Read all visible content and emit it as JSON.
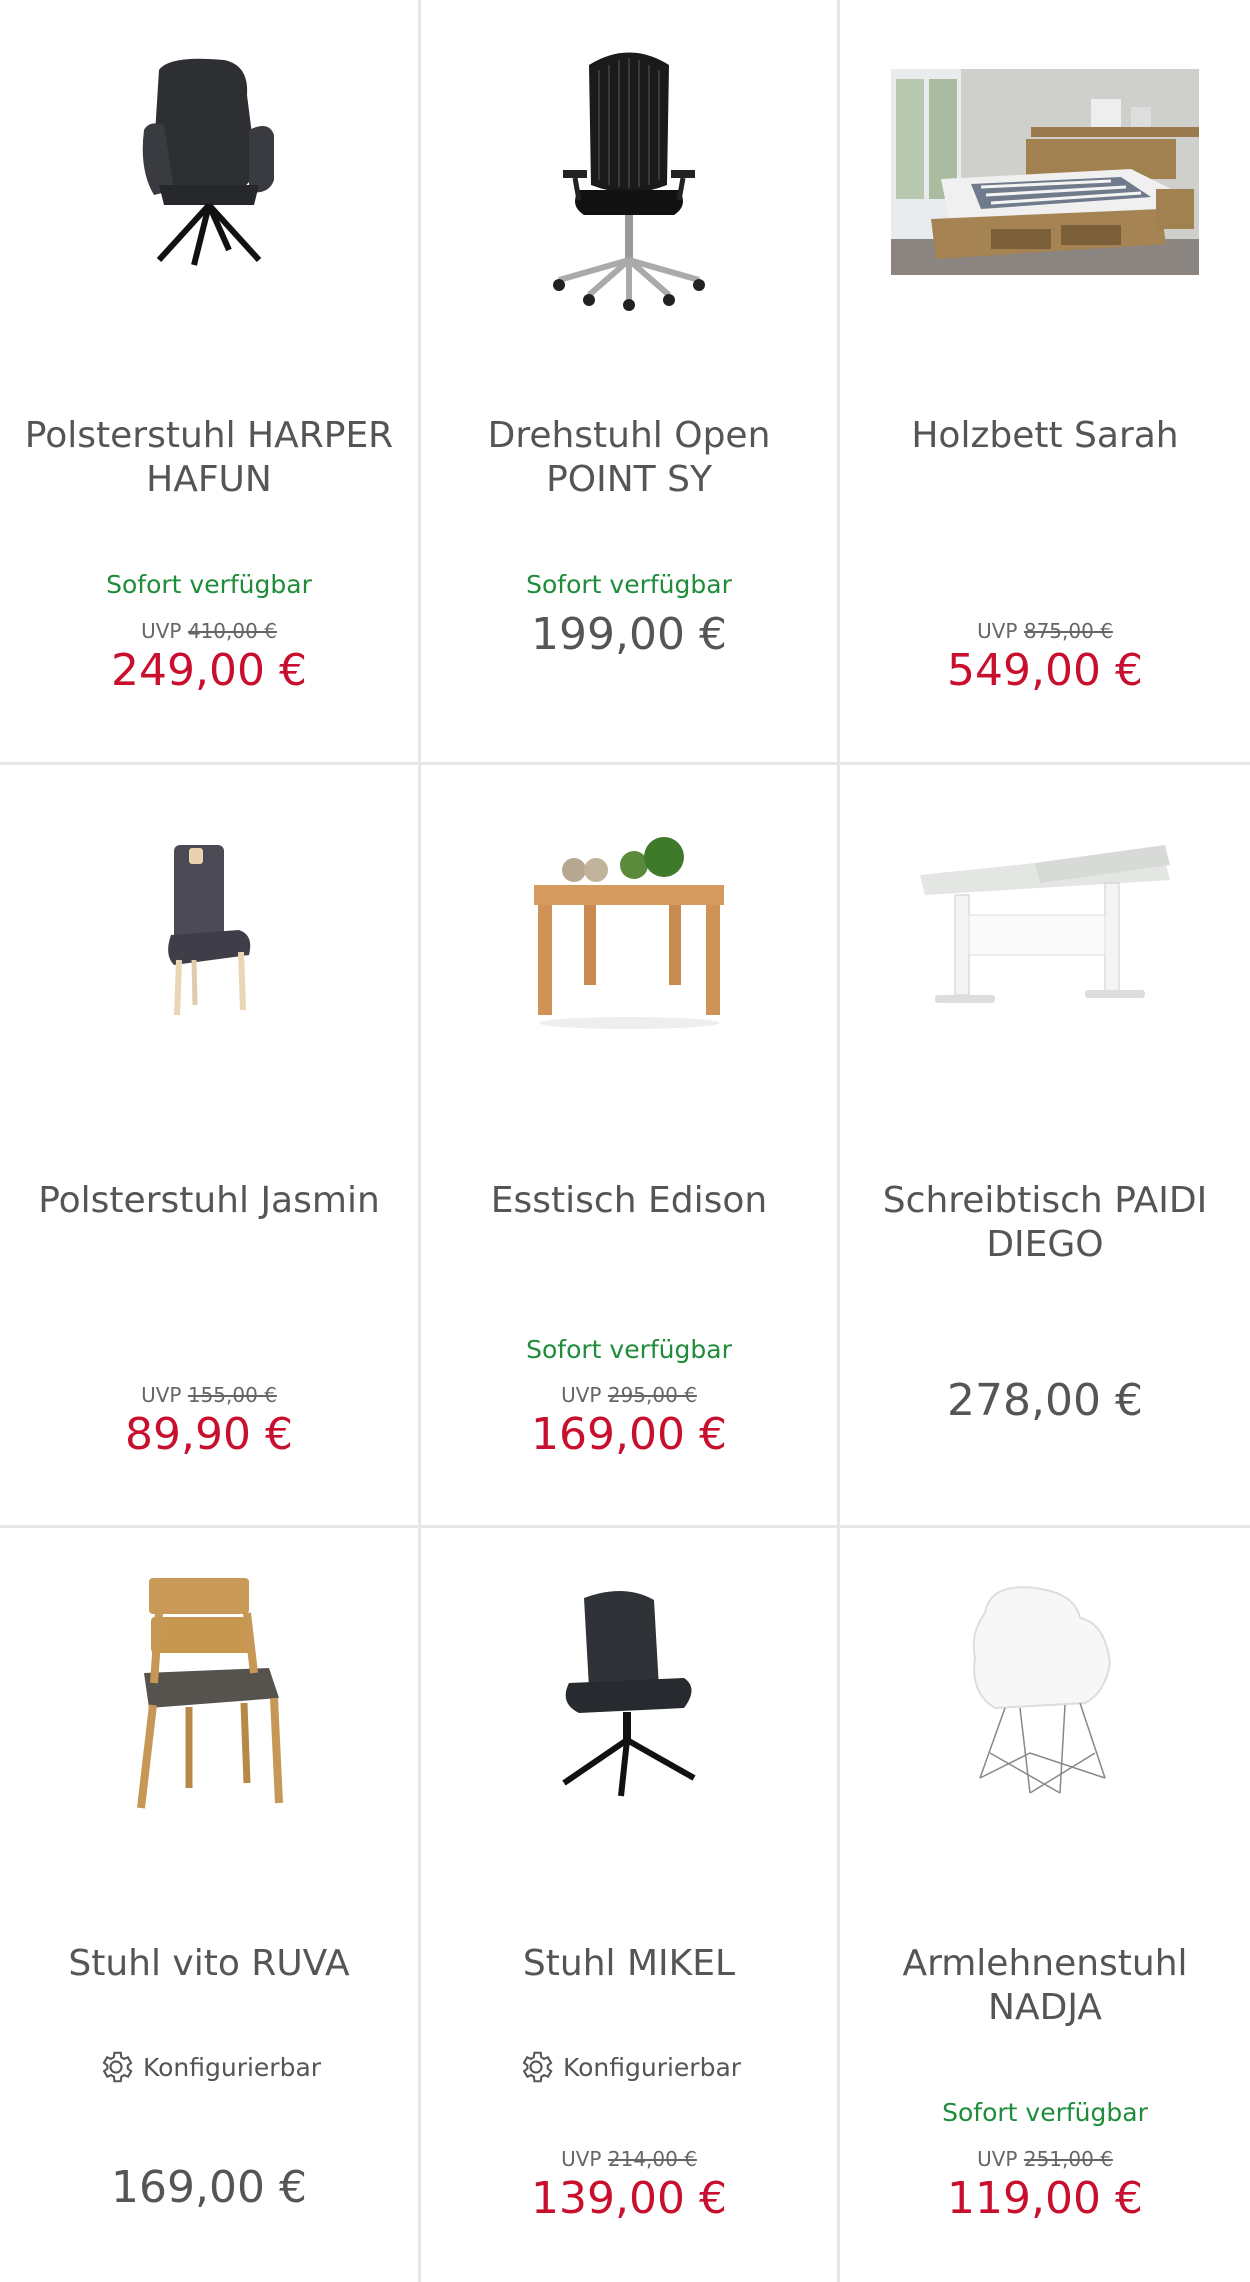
{
  "products": [
    {
      "name": "Polsterstuhl HARPER HAFUN",
      "availability": "Sofort verfügbar",
      "uvp_label": "UVP",
      "uvp_price": "410,00 €",
      "price": "249,00 €",
      "image": "upholstered-swivel-chair"
    },
    {
      "name": "Drehstuhl Open POINT SY",
      "availability": "Sofort verfügbar",
      "price": "199,00 €",
      "image": "office-chair"
    },
    {
      "name": "Holzbett Sarah",
      "uvp_label": "UVP",
      "uvp_price": "875,00 €",
      "price": "549,00 €",
      "image": "wooden-bed-photo"
    },
    {
      "name": "Polsterstuhl Jasmin",
      "uvp_label": "UVP",
      "uvp_price": "155,00 €",
      "price": "89,90 €",
      "image": "upholstered-chair"
    },
    {
      "name": "Esstisch Edison",
      "availability": "Sofort verfügbar",
      "uvp_label": "UVP",
      "uvp_price": "295,00 €",
      "price": "169,00 €",
      "image": "dining-table"
    },
    {
      "name": "Schreibtisch PAIDI DIEGO",
      "price": "278,00 €",
      "image": "desk"
    },
    {
      "name": "Stuhl vito RUVA",
      "configurable": "Konfigurierbar",
      "price": "169,00 €",
      "image": "wooden-chair"
    },
    {
      "name": "Stuhl MIKEL",
      "configurable": "Konfigurierbar",
      "uvp_label": "UVP",
      "uvp_price": "214,00 €",
      "price": "139,00 €",
      "image": "swivel-chair"
    },
    {
      "name": "Armlehnenstuhl NADJA",
      "availability": "Sofort verfügbar",
      "uvp_label": "UVP",
      "uvp_price": "251,00 €",
      "price": "119,00 €",
      "image": "white-shell-chair"
    }
  ],
  "colors": {
    "sale_price": "#c8102e",
    "availability": "#1e8c3a",
    "text": "#555555",
    "divider": "#e6e6e6"
  }
}
